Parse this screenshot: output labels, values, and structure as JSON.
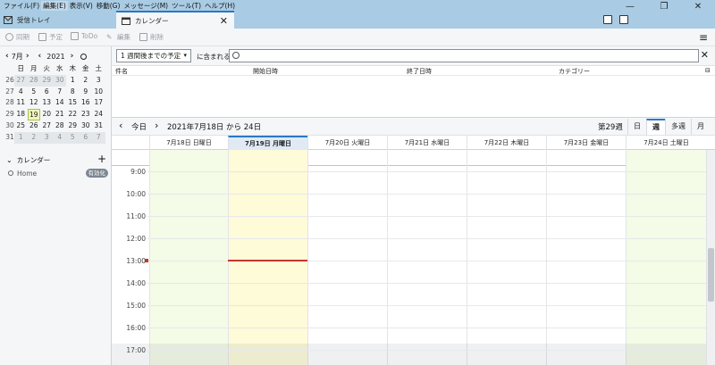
{
  "menu": [
    "ファイル(F)",
    "編集(E)",
    "表示(V)",
    "移動(G)",
    "メッセージ(M)",
    "ツール(T)",
    "ヘルプ(H)"
  ],
  "window_controls": {
    "minimize": "—",
    "restore": "❐",
    "close": "✕"
  },
  "tabs": {
    "mail": "受信トレイ",
    "calendar": "カレンダー",
    "close": "✕"
  },
  "toolbar": {
    "sync": "同期",
    "event": "予定",
    "todo": "ToDo",
    "edit": "編集",
    "delete": "削除",
    "menu": "≡"
  },
  "minical": {
    "month": "7月",
    "year": "2021",
    "weekday_headers": [
      "日",
      "月",
      "火",
      "水",
      "木",
      "金",
      "土"
    ],
    "weeks": [
      {
        "num": "26",
        "days": [
          "27",
          "28",
          "29",
          "30",
          "1",
          "2",
          "3"
        ]
      },
      {
        "num": "27",
        "days": [
          "4",
          "5",
          "6",
          "7",
          "8",
          "9",
          "10"
        ]
      },
      {
        "num": "28",
        "days": [
          "11",
          "12",
          "13",
          "14",
          "15",
          "16",
          "17"
        ]
      },
      {
        "num": "29",
        "days": [
          "18",
          "19",
          "20",
          "21",
          "22",
          "23",
          "24"
        ]
      },
      {
        "num": "30",
        "days": [
          "25",
          "26",
          "27",
          "28",
          "29",
          "30",
          "31"
        ]
      },
      {
        "num": "31",
        "days": [
          "1",
          "2",
          "3",
          "4",
          "5",
          "6",
          "7"
        ]
      }
    ]
  },
  "calendars": {
    "header": "カレンダー",
    "add": "+",
    "items": [
      {
        "name": "Home",
        "badge": "有効化"
      }
    ]
  },
  "filter": {
    "selected": "1 週間後までの予定",
    "label": "に含まれる",
    "search_placeholder": "",
    "clear": "✕"
  },
  "list_columns": [
    "件名",
    "開始日時",
    "終了日時",
    "カテゴリー"
  ],
  "weeknav": {
    "prev": "‹",
    "today": "今日",
    "next": "›",
    "range": "2021年7月18日 から 24日",
    "week_number": "第29週"
  },
  "views": [
    "日",
    "週",
    "多週",
    "月"
  ],
  "days": [
    "7月18日 日曜日",
    "7月19日 月曜日",
    "7月20日 火曜日",
    "7月21日 水曜日",
    "7月22日 木曜日",
    "7月23日 金曜日",
    "7月24日 土曜日"
  ],
  "hours": [
    "9:00",
    "10:00",
    "11:00",
    "12:00",
    "13:00",
    "14:00",
    "15:00",
    "16:00",
    "17:00"
  ],
  "colors": {
    "accent": "#2b78c4",
    "titlebar": "#a9cbe3",
    "today": "#fdfbd8",
    "weekend": "#f4fbe6",
    "now": "#c0392b"
  }
}
